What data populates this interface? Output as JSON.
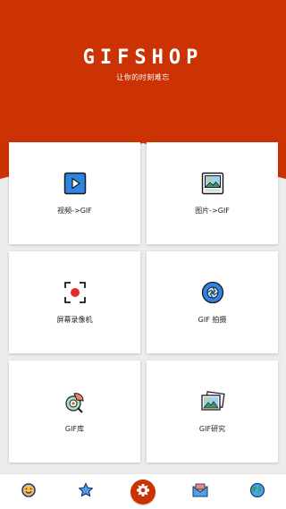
{
  "app": {
    "brand": "GIFSHOP",
    "slogan": "让你的时刻难忘"
  },
  "colors": {
    "accent": "#cc3304",
    "background": "#ececec",
    "card": "#ffffff"
  },
  "cards": [
    {
      "label": "视频->GIF",
      "icon": "video-play-icon"
    },
    {
      "label": "图片->GIF",
      "icon": "picture-icon"
    },
    {
      "label": "屏幕录像机",
      "icon": "screen-record-icon"
    },
    {
      "label": "GIF 拍摄",
      "icon": "camera-aperture-icon"
    },
    {
      "label": "GIF库",
      "icon": "gif-library-icon"
    },
    {
      "label": "GIF研究",
      "icon": "gif-research-icon"
    }
  ],
  "tabbar": {
    "items": [
      {
        "icon": "smiley-icon"
      },
      {
        "icon": "star-icon"
      },
      {
        "icon": "settings-gear-icon",
        "active": true
      },
      {
        "icon": "mail-icon"
      },
      {
        "icon": "globe-icon"
      }
    ]
  }
}
